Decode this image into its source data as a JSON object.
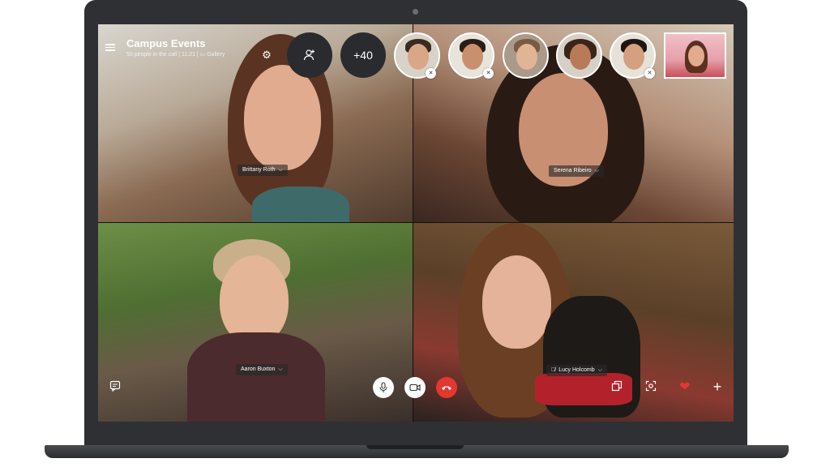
{
  "call": {
    "title": "Campus Events",
    "subtitle": "50 people in the call | 11:21 | ▭ Gallery"
  },
  "header": {
    "overflow_count": "+40"
  },
  "tiles": [
    {
      "name": "Brittany Roth",
      "muted": false
    },
    {
      "name": "Serena Ribeiro",
      "muted": false
    },
    {
      "name": "Aaron Buxton",
      "muted": false
    },
    {
      "name": "Lucy Holcomb",
      "muted": true
    }
  ],
  "icons": {
    "menu": "hamburger-icon",
    "settings": "gear-icon",
    "add_people": "add-person-icon",
    "mic": "microphone-icon",
    "video": "video-camera-icon",
    "hangup": "phone-hangup-icon",
    "chat": "chat-icon",
    "share": "share-screen-icon",
    "snapshot": "snapshot-icon",
    "react": "heart-icon",
    "more": "plus-icon"
  },
  "colors": {
    "hangup": "#e4382f",
    "heart": "#e4382f",
    "laptop": "#2f3033"
  }
}
